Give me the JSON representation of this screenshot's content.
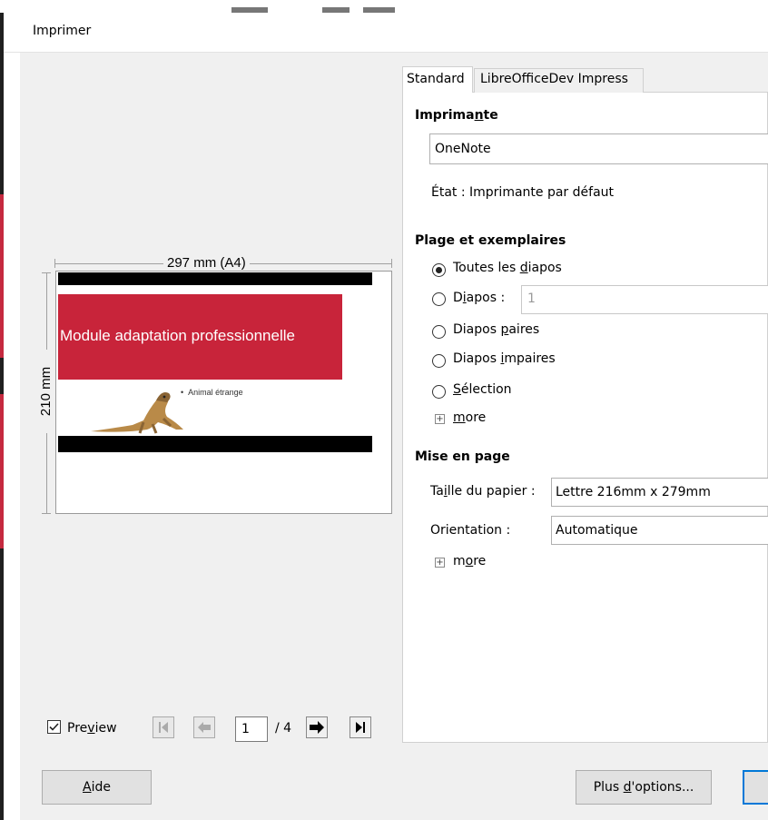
{
  "window": {
    "title": "Imprimer"
  },
  "preview": {
    "width_label": "297 mm (A4)",
    "height_label": "210 mm",
    "slide_title": "Module adaptation professionnelle",
    "slide_bullet": "Animal étrange",
    "preview_label_pre": "Pre",
    "preview_label_u": "v",
    "preview_label_post": "iew",
    "preview_checked": true,
    "current_page": "1",
    "total_pages": "/ 4"
  },
  "tabs": [
    {
      "label": "Standard",
      "active": true
    },
    {
      "label": "LibreOfficeDev Impress",
      "active": false
    }
  ],
  "printer": {
    "section_pre": "Imprima",
    "section_u": "n",
    "section_post": "te",
    "selected": "OneNote",
    "status": "État : Imprimante par défaut"
  },
  "range": {
    "section": "Plage et exemplaires",
    "options": [
      {
        "pre": "Toutes les ",
        "u": "d",
        "post": "iapos",
        "selected": true
      },
      {
        "pre": "D",
        "u": "i",
        "post": "apos :",
        "selected": false
      },
      {
        "pre": "Diapos ",
        "u": "p",
        "post": "aires",
        "selected": false
      },
      {
        "pre": "Diapos ",
        "u": "i",
        "post": "mpaires",
        "selected": false
      },
      {
        "pre": "",
        "u": "S",
        "post": "élection",
        "selected": false
      }
    ],
    "slides_value": "1",
    "more_u": "m",
    "more_post": "ore"
  },
  "layout": {
    "section": "Mise en page",
    "paper_label_pre": "Ta",
    "paper_label_u": "i",
    "paper_label_post": "lle du papier :",
    "paper_value": "Lettre 216mm x 279mm",
    "orientation_label": "Orientation :",
    "orientation_value": "Automatique",
    "more_pre": "m",
    "more_u": "o",
    "more_post": "re"
  },
  "buttons": {
    "help_u": "A",
    "help_post": "ide",
    "more_options_pre": "Plus ",
    "more_options_u": "d",
    "more_options_post": "'options..."
  },
  "colors": {
    "slide_red": "#c8243a",
    "ok_border": "#0078d7"
  }
}
